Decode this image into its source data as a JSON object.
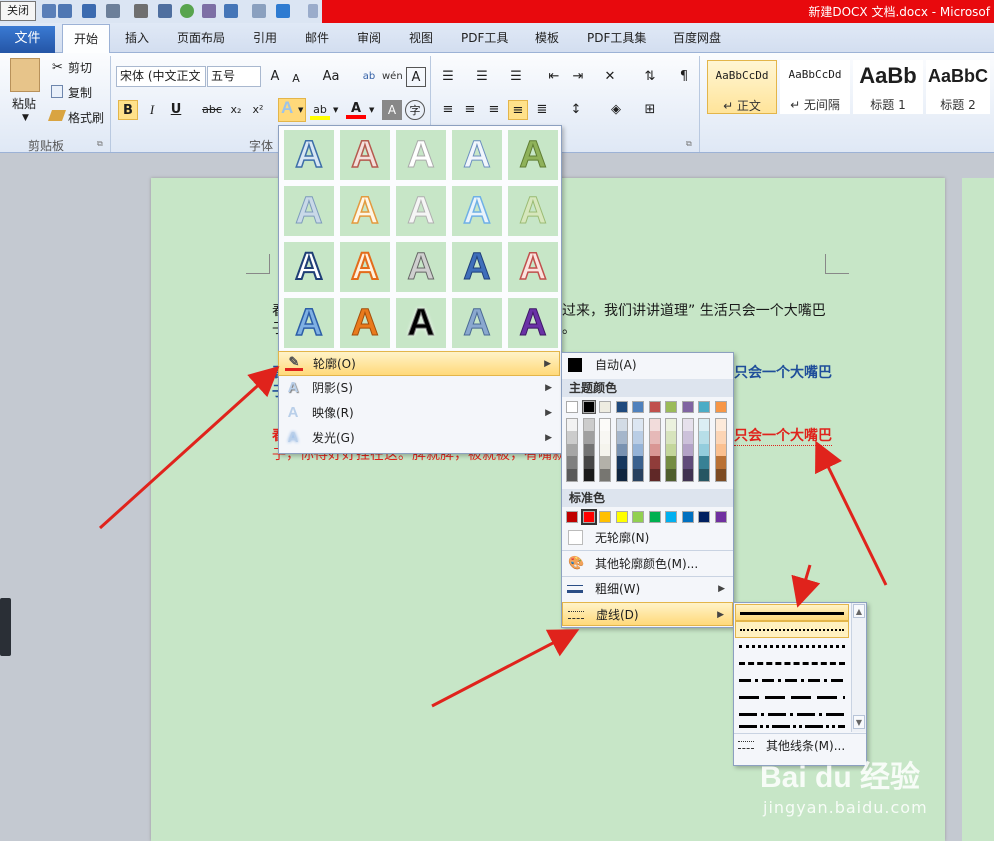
{
  "window": {
    "close_tooltip": "关闭",
    "doc_title": "新建DOCX 文档.docx - Microsof"
  },
  "tabs": [
    "文件",
    "开始",
    "插入",
    "页面布局",
    "引用",
    "邮件",
    "审阅",
    "视图",
    "PDF工具",
    "模板",
    "PDF工具集",
    "百度网盘"
  ],
  "clipboard": {
    "paste": "粘贴",
    "cut": "剪切",
    "copy": "复制",
    "format_painter": "格式刷",
    "group_label": "剪贴板"
  },
  "font": {
    "font_name": "宋体 (中文正文",
    "font_size": "五号",
    "group_label": "字体",
    "bold": "B",
    "italic": "I",
    "underline": "U",
    "strike": "abc",
    "subscript": "x₂",
    "superscript": "x²",
    "grow": "A",
    "shrink": "A",
    "case": "Aa"
  },
  "styles": [
    {
      "preview": "AaBbCcDd",
      "name": "↵ 正文"
    },
    {
      "preview": "AaBbCcDd",
      "name": "↵ 无间隔"
    },
    {
      "preview": "AaBb",
      "name": "标题 1"
    },
    {
      "preview": "AaBbC",
      "name": "标题 2"
    }
  ],
  "document": {
    "line1_start": "春",
    "line1_end": "过来，我们讲讲道理” 生活只会一个大嘴巴",
    "line2_start": "子",
    "line2_end": "。",
    "line3_start": "春",
    "line3_end": "只会一个大嘴巴",
    "line4_start": "子",
    "line5_start": "春",
    "line5_end": "只会一个大嘴巴",
    "line6": "子，你得好好挂在这。脾就脾，被就被，有嘴就一个嘴巴"
  },
  "text_effects_menu": {
    "items": [
      {
        "label": "轮廓(O)",
        "icon": "pen-icon"
      },
      {
        "label": "阴影(S)",
        "icon": "A"
      },
      {
        "label": "映像(R)",
        "icon": "A"
      },
      {
        "label": "发光(G)",
        "icon": "A"
      }
    ]
  },
  "outline_menu": {
    "auto": "自动(A)",
    "theme_colors_header": "主题颜色",
    "standard_colors_header": "标准色",
    "no_outline": "无轮廓(N)",
    "more_colors": "其他轮廓颜色(M)...",
    "weight": "粗细(W)",
    "dashes": "虚线(D)",
    "theme_top": [
      "#ffffff",
      "#000000",
      "#eeece1",
      "#1f497d",
      "#4f81bd",
      "#c0504d",
      "#9bbb59",
      "#8064a2",
      "#4bacc6",
      "#f79646"
    ],
    "standard": [
      "#c00000",
      "#ff0000",
      "#ffc000",
      "#ffff00",
      "#92d050",
      "#00b050",
      "#00b0f0",
      "#0070c0",
      "#002060",
      "#7030a0"
    ]
  },
  "dashes_menu": {
    "more_lines": "其他线条(M)..."
  },
  "watermark": {
    "brand": "Bai du 经验",
    "url": "jingyan.baidu.com"
  }
}
